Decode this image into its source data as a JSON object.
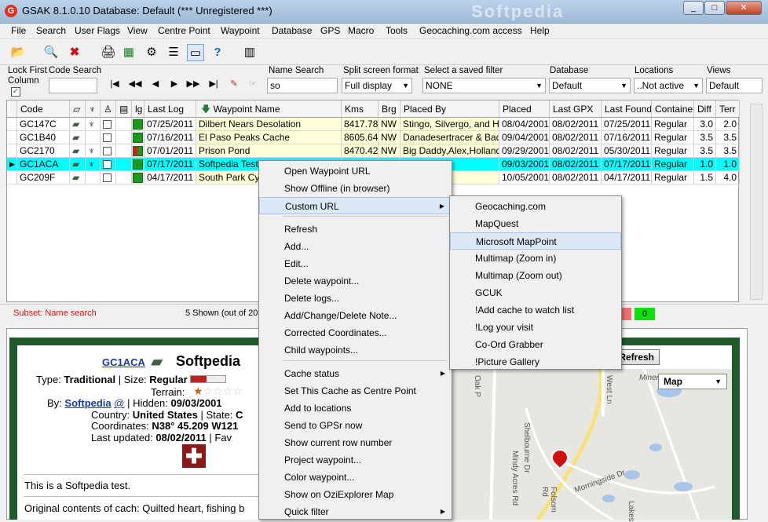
{
  "window": {
    "title": "GSAK 8.1.0.10   Database: Default   (*** Unregistered ***)",
    "icon": "gsak-app-icon",
    "watermark": "Softpedia"
  },
  "menus": [
    "File",
    "Search",
    "User Flags",
    "View",
    "Centre Point",
    "Waypoint",
    "Database",
    "GPS",
    "Macro",
    "Tools",
    "Geocaching.com access",
    "Help"
  ],
  "toolbar_icons": [
    "open-folder-icon",
    "print-preview-icon",
    "delete-x-icon",
    "print-icon",
    "grid-icon",
    "filter-icon",
    "window-icon",
    "help-icon",
    "gps-device-icon"
  ],
  "filterbar": {
    "lock_first": "Lock First",
    "column": "Column",
    "code_search": "Code Search",
    "name_search": "Name Search",
    "name_search_value": "so",
    "split_label": "Split screen format",
    "split_value": "Full display",
    "saved_filter_label": "Select a saved filter",
    "saved_filter_value": "NONE",
    "database_label": "Database",
    "database_value": "Default",
    "locations_label": "Locations",
    "locations_value": "..Not active",
    "views_label": "Views",
    "views_value": "Default"
  },
  "grid": {
    "headers": {
      "code": "Code",
      "lg": "lg",
      "last_log": "Last Log",
      "waypoint_name": "Waypoint Name",
      "kms": "Kms",
      "brg": "Brg",
      "placed_by": "Placed By",
      "placed": "Placed",
      "last_gpx": "Last GPX",
      "last_found": "Last Found",
      "container": "Container",
      "diff": "Diff",
      "terr": "Terr"
    },
    "rows": [
      {
        "code": "GC147C",
        "last_log": "07/25/2011",
        "name": "Dilbert Nears Desolation",
        "kms": "8417.78",
        "brg": "NW",
        "placed_by": "Stingo, Silvergo, and Ho",
        "placed": "08/04/2001",
        "last_gpx": "08/02/2011",
        "last_found": "07/25/2011",
        "container": "Regular",
        "diff": "3.0",
        "terr": "2.0"
      },
      {
        "code": "GC1B40",
        "last_log": "07/16/2011",
        "name": "El Paso Peaks Cache",
        "kms": "8605.64",
        "brg": "NW",
        "placed_by": "Danadesertracer & Bad-Bi",
        "placed": "09/04/2001",
        "last_gpx": "08/02/2011",
        "last_found": "07/16/2011",
        "container": "Regular",
        "diff": "3.5",
        "terr": "3.5"
      },
      {
        "code": "GC2170",
        "last_log": "07/01/2011",
        "name": "Prison Pond",
        "kms": "8470.42",
        "brg": "NW",
        "placed_by": "Big Daddy,Alex,Holland a",
        "placed": "09/29/2001",
        "last_gpx": "08/02/2011",
        "last_found": "05/30/2011",
        "container": "Regular",
        "diff": "3.5",
        "terr": "3.5"
      },
      {
        "code": "GC1ACA",
        "last_log": "07/17/2011",
        "name": "Softpedia Test",
        "kms": "",
        "brg": "",
        "placed_by": "",
        "placed": "09/03/2001",
        "last_gpx": "08/02/2011",
        "last_found": "07/17/2011",
        "container": "Regular",
        "diff": "1.0",
        "terr": "1.0"
      },
      {
        "code": "GC209F",
        "last_log": "04/17/2011",
        "name": "South Park Cyn...",
        "kms": "",
        "brg": "",
        "placed_by": "",
        "placed": "10/05/2001",
        "last_gpx": "08/02/2011",
        "last_found": "04/17/2011",
        "container": "Regular",
        "diff": "1.5",
        "terr": "4.0"
      }
    ]
  },
  "status": {
    "subset": "Subset:  Name search",
    "shown": "5 Shown (out of 20",
    "zero": "0"
  },
  "cache": {
    "code": "GC1ACA",
    "name": "Softpedia",
    "type_label": "Type:",
    "type": "Traditional",
    "size_label": "Size:",
    "size": "Regular",
    "terrain_label": "Terrain:",
    "by_label": "By:",
    "by": "Softpedia",
    "at": "@",
    "hidden_label": "Hidden:",
    "hidden": "09/03/2001",
    "country_label": "Country:",
    "country": "United States",
    "state_label": "State:",
    "state": "C",
    "coords_label": "Coordinates:",
    "coords": "N38° 45.209 W121",
    "updated_label": "Last updated:",
    "updated": "08/02/2011",
    "fav": "Fav",
    "description": "This is a Softpedia test.",
    "original": "Original contents of cach: Quilted heart, fishing b",
    "refresh": "Refresh",
    "map_type": "Map",
    "streets": [
      "Oak P",
      "West Ln",
      "Shelbourne Dr",
      "Mindy Acres Rd",
      "Morningside Dr",
      "Lakes",
      "Miners",
      "Folsom Rd"
    ]
  },
  "context_menu": [
    {
      "label": "Open Waypoint URL"
    },
    {
      "label": "Show Offline (in browser)"
    },
    {
      "label": "Custom URL",
      "submenu": true
    },
    {
      "label": "Refresh"
    },
    {
      "label": "Add..."
    },
    {
      "label": "Edit..."
    },
    {
      "label": "Delete waypoint..."
    },
    {
      "label": "Delete logs..."
    },
    {
      "label": "Add/Change/Delete Note..."
    },
    {
      "label": "Corrected Coordinates..."
    },
    {
      "label": "Child waypoints..."
    },
    {
      "label": "Cache status",
      "submenu": true
    },
    {
      "label": "Set This Cache as Centre Point"
    },
    {
      "label": "Add to locations"
    },
    {
      "label": "Send to GPSr now"
    },
    {
      "label": "Show current row number"
    },
    {
      "label": "Project waypoint..."
    },
    {
      "label": "Color waypoint..."
    },
    {
      "label": "Show on OziExplorer Map"
    },
    {
      "label": "Quick filter",
      "submenu": true
    }
  ],
  "submenu": [
    "Geocaching.com",
    "MapQuest",
    "Microsoft MapPoint",
    "Multimap (Zoom in)",
    "Multimap (Zoom out)",
    "GCUK",
    "!Add  cache to watch list",
    "!Log your visit",
    "Co-Ord Grabber",
    "!Picture Gallery"
  ]
}
